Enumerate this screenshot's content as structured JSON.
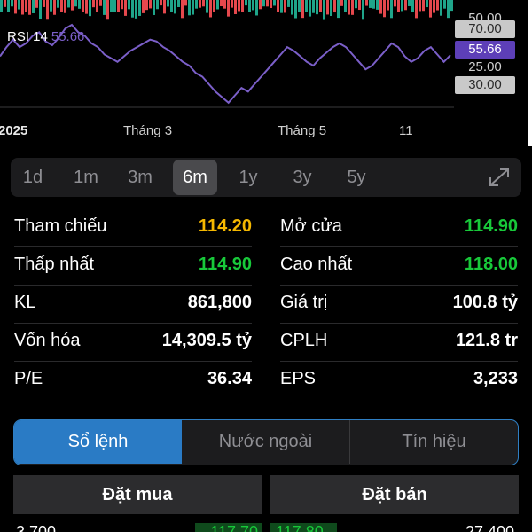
{
  "chart": {
    "rsi_label": "RSI 14",
    "rsi_value": "55.66",
    "axis_tags": {
      "top_cut": "50.00",
      "upper": "70.00",
      "current": "55.66",
      "mid": "25.00",
      "lower": "30.00"
    },
    "date_labels": [
      "2025",
      "Tháng 3",
      "Tháng 5",
      "11"
    ],
    "rsi_series": [
      55,
      60,
      64,
      60,
      62,
      66,
      68,
      63,
      61,
      65,
      70,
      72,
      68,
      66,
      62,
      60,
      56,
      54,
      52,
      55,
      58,
      60,
      62,
      64,
      63,
      60,
      58,
      55,
      52,
      50,
      46,
      44,
      40,
      36,
      33,
      30,
      34,
      38,
      36,
      40,
      44,
      48,
      52,
      56,
      60,
      58,
      55,
      52,
      50,
      54,
      57,
      60,
      62,
      60,
      56,
      52,
      48,
      50,
      54,
      58,
      62,
      60,
      55,
      52,
      54,
      58,
      60,
      56,
      52,
      55.66
    ],
    "colors": {
      "rsi_line": "#7b5fc9",
      "up": "#1fa58a",
      "down": "#e5484d"
    }
  },
  "range_tabs": [
    "1d",
    "1m",
    "3m",
    "6m",
    "1y",
    "3y",
    "5y"
  ],
  "range_active": "6m",
  "icons": {
    "expand": "expand-icon"
  },
  "stats": {
    "left": [
      {
        "label": "Tham chiếu",
        "value": "114.20",
        "color": "yellow"
      },
      {
        "label": "Thấp nhất",
        "value": "114.90",
        "color": "green"
      },
      {
        "label": "KL",
        "value": "861,800",
        "color": "white"
      },
      {
        "label": "Vốn hóa",
        "value": "14,309.5 tỷ",
        "color": "white"
      },
      {
        "label": "P/E",
        "value": "36.34",
        "color": "white"
      }
    ],
    "right": [
      {
        "label": "Mở cửa",
        "value": "114.90",
        "color": "green"
      },
      {
        "label": "Cao nhất",
        "value": "118.00",
        "color": "green"
      },
      {
        "label": "Giá trị",
        "value": "100.8 tỷ",
        "color": "white"
      },
      {
        "label": "CPLH",
        "value": "121.8 tr",
        "color": "white"
      },
      {
        "label": "EPS",
        "value": "3,233",
        "color": "white"
      }
    ]
  },
  "segments": [
    "Sổ lệnh",
    "Nước ngoài",
    "Tín hiệu"
  ],
  "segment_active": "Sổ lệnh",
  "order_book": {
    "buy_header": "Đặt mua",
    "sell_header": "Đặt bán",
    "first_row": {
      "buy_vol": "3,700",
      "buy_price": "117.70",
      "sell_price": "117.80",
      "sell_vol": "27,400"
    }
  }
}
